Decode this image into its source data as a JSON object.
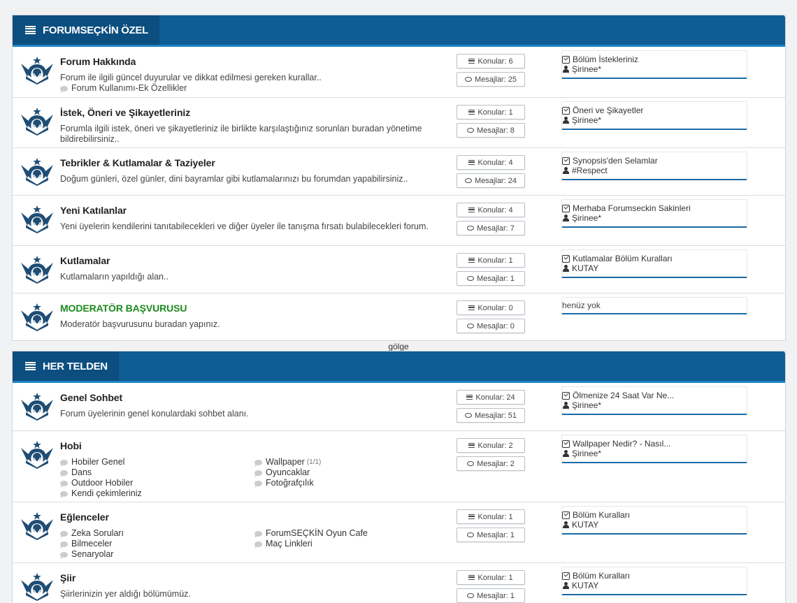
{
  "colors": {
    "header": "#0e5d95",
    "header_box": "#0b4e7f",
    "accent": "#1a6aa5",
    "moderator_green": "#1c8a1c"
  },
  "categories": [
    {
      "title": "FORUMSEÇKİN ÖZEL",
      "forums": [
        {
          "title": "Forum Hakkında",
          "desc": "Forum ile ilgili güncel duyurular ve dikkat edilmesi gereken kurallar..",
          "subforums": [
            "Forum Kullanımı-Ek Özellikler"
          ],
          "topics": "Konular: 6",
          "posts": "Mesajlar: 25",
          "last_title": "Bölüm İstekleriniz",
          "last_user": "Şirinee*"
        },
        {
          "title": "İstek, Öneri ve Şikayetleriniz",
          "desc": "Forumla ilgili istek, öneri ve şikayetleriniz ile birlikte karşılaştığınız sorunları buradan yönetime bildirebilirsiniz..",
          "topics": "Konular: 1",
          "posts": "Mesajlar: 8",
          "last_title": "Öneri ve Şikayetler",
          "last_user": "Şirinee*"
        },
        {
          "title": "Tebrikler & Kutlamalar & Taziyeler",
          "desc": "Doğum günleri, özel günler, dini bayramlar gibi kutlamalarınızı bu forumdan yapabilirsiniz..",
          "topics": "Konular: 4",
          "posts": "Mesajlar: 24",
          "last_title": "Synopsis'den Selamlar",
          "last_user": "#Respect"
        },
        {
          "title": "Yeni Katılanlar",
          "desc": "Yeni üyelerin kendilerini tanıtabilecekleri ve diğer üyeler ile tanışma fırsatı bulabilecekleri forum.",
          "topics": "Konular: 4",
          "posts": "Mesajlar: 7",
          "last_title": "Merhaba Forumseckin Sakinleri",
          "last_user": "Şirinee*"
        },
        {
          "title": "Kutlamalar",
          "desc": "Kutlamaların yapıldığı alan..",
          "topics": "Konular: 1",
          "posts": "Mesajlar: 1",
          "last_title": "Kutlamalar Bölüm Kuralları",
          "last_user": "KUTAY"
        },
        {
          "title": "MODERATÖR BAŞVURUSU",
          "desc": "Moderatör başvurusunu buradan yapınız.",
          "topics": "Konular: 0",
          "posts": "Mesajlar: 0",
          "last_empty": "henüz yok"
        }
      ]
    },
    {
      "title": "HER TELDEN",
      "forums": [
        {
          "title": "Genel Sohbet",
          "desc": "Forum üyelerinin genel konulardaki sohbet alanı.",
          "topics": "Konular: 24",
          "posts": "Mesajlar: 51",
          "last_title": "Ölmenize 24 Saat Var Ne...",
          "last_user": "Şirinee*"
        },
        {
          "title": "Hobi",
          "subforums": [
            "Hobiler Genel",
            "Dans",
            "Outdoor Hobiler",
            "Kendi çekimleriniz",
            "Wallpaper",
            "Oyuncaklar",
            "Fotoğrafçılık"
          ],
          "wallpaper_count": "(1/1)",
          "topics": "Konular: 2",
          "posts": "Mesajlar: 2",
          "last_title": "Wallpaper Nedir? - Nasıl...",
          "last_user": "Şirinee*"
        },
        {
          "title": "Eğlenceler",
          "subforums": [
            "Zeka Soruları",
            "Bilmeceler",
            "Senaryolar",
            "ForumSEÇKİN Oyun Cafe",
            "Maç Linkleri"
          ],
          "topics": "Konular: 1",
          "posts": "Mesajlar: 1",
          "last_title": "Bölüm Kuralları",
          "last_user": "KUTAY"
        },
        {
          "title": "Şiir",
          "desc": "Şiirlerinizin yer aldığı bölümümüz.",
          "topics": "Konular: 1",
          "posts": "Mesajlar: 1",
          "last_title": "Bölüm Kuralları",
          "last_user": "KUTAY"
        }
      ]
    }
  ],
  "separator_label": "gölge"
}
